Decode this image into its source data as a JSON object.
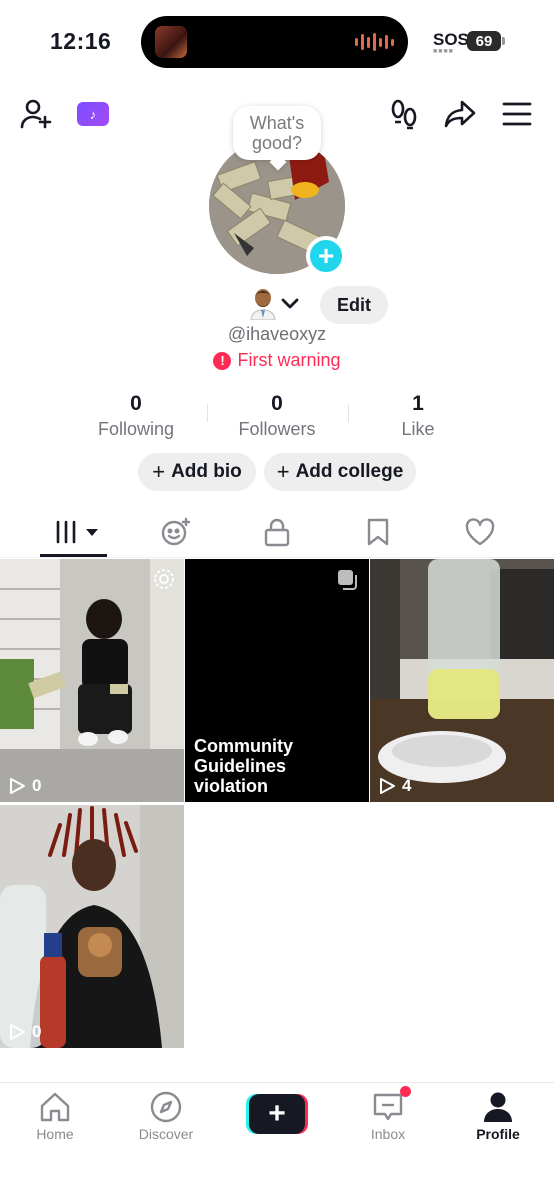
{
  "status_bar": {
    "time": "12:16",
    "carrier": "SOS",
    "battery": "69"
  },
  "profile": {
    "note_bubble": "What's good?",
    "handle": "@ihaveoxyz",
    "warning": "First warning",
    "edit_label": "Edit",
    "stats": [
      {
        "value": "0",
        "label": "Following"
      },
      {
        "value": "0",
        "label": "Followers"
      },
      {
        "value": "1",
        "label": "Like"
      }
    ],
    "add_bio": "Add bio",
    "add_college": "Add college"
  },
  "tabs": [
    "videos-icon",
    "reposts-icon",
    "private-icon",
    "favorites-icon",
    "liked-icon"
  ],
  "videos": [
    {
      "views": "0"
    },
    {
      "violation_text": "Community Guidelines violation"
    },
    {
      "views": "4"
    },
    {
      "views": "0"
    }
  ],
  "nav": {
    "home": "Home",
    "discover": "Discover",
    "inbox": "Inbox",
    "profile": "Profile"
  },
  "colors": {
    "accent_red": "#fe2c55",
    "accent_cyan": "#25f4ee",
    "plus_blue": "#20d5ec"
  }
}
